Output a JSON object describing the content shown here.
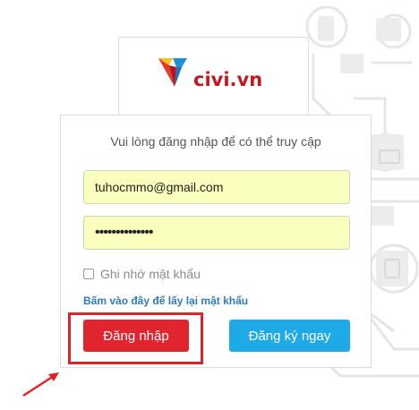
{
  "logo": {
    "text": "civi.vn"
  },
  "login": {
    "title": "Vui lòng đăng nhập để có thể truy cập",
    "email_value": "tuhocmmo@gmail.com",
    "password_value": "••••••••••••••",
    "remember_label": "Ghi nhớ mật khẩu",
    "remember_checked": false,
    "forgot_link": "Bấm vào đây để lấy lại mật khẩu",
    "login_button": "Đăng nhập",
    "register_button": "Đăng ký ngay"
  },
  "colors": {
    "brand_red": "#c5171e",
    "login_button": "#e0252f",
    "register_button": "#1eaae7",
    "autofill_bg": "#faffbd",
    "annotation": "#e0222a",
    "link": "#2f7bbf"
  }
}
